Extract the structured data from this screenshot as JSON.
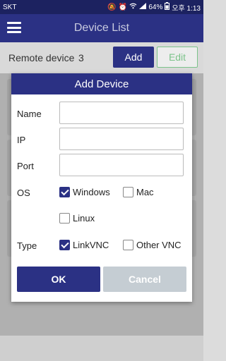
{
  "status_bar": {
    "carrier": "SKT",
    "battery": "64%",
    "time": "오후 1:13"
  },
  "app_bar": {
    "title": "Device List"
  },
  "device_row": {
    "label": "Remote device",
    "count": "3",
    "add_label": "Add",
    "edit_label": "Edit"
  },
  "dialog": {
    "title": "Add Device",
    "fields": {
      "name_label": "Name",
      "name_value": "",
      "ip_label": "IP",
      "ip_value": "",
      "port_label": "Port",
      "port_value": ""
    },
    "os": {
      "label": "OS",
      "windows": "Windows",
      "windows_checked": true,
      "mac": "Mac",
      "mac_checked": false,
      "linux": "Linux",
      "linux_checked": false
    },
    "type": {
      "label": "Type",
      "linkvnc": "LinkVNC",
      "linkvnc_checked": true,
      "othervnc": "Other VNC",
      "othervnc_checked": false
    },
    "ok_label": "OK",
    "cancel_label": "Cancel"
  },
  "colors": {
    "primary": "#2b3184",
    "status_bar": "#1c2260",
    "edit_green": "#7cc38a",
    "cancel_gray": "#c5cdd3"
  }
}
